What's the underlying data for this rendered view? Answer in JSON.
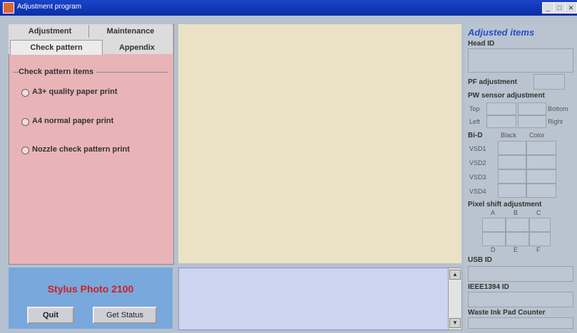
{
  "window": {
    "title": "Adjustment program",
    "controls": [
      "_",
      "□",
      "✕"
    ]
  },
  "tabs": {
    "row1": [
      "Adjustment",
      "Maintenance"
    ],
    "row2": [
      "Check pattern",
      "Appendix"
    ],
    "active": "Check pattern"
  },
  "check_pattern": {
    "group_label": "Check pattern items",
    "options": [
      "A3+ quality paper print",
      "A4 normal paper print",
      "Nozzle check pattern print"
    ]
  },
  "footer": {
    "printer_model": "Stylus Photo 2100",
    "quit_label": "Quit",
    "status_label": "Get Status"
  },
  "adjusted_items": {
    "heading": "Adjusted items",
    "head_id_label": "Head ID",
    "pf_label": "PF adjustment",
    "pw_label": "PW sensor adjustment",
    "pw_positions": {
      "top": "Top",
      "bottom": "Bottom",
      "left": "Left",
      "right": "Right"
    },
    "bid_label": "Bi-D",
    "bid_cols": [
      "Black",
      "Color"
    ],
    "bid_rows": [
      "VSD1",
      "VSD2",
      "VSD3",
      "VSD4"
    ],
    "pixel_shift_label": "Pixel shift adjustment",
    "pixel_cols_top": [
      "A",
      "B",
      "C"
    ],
    "pixel_cols_bottom": [
      "D",
      "E",
      "F"
    ],
    "usb_label": "USB ID",
    "ieee_label": "IEEE1394 ID",
    "waste_label": "Waste Ink Pad Counter"
  },
  "scroll": {
    "up": "▲",
    "down": "▼"
  },
  "colors": {
    "title_bar": "#0c2ea8",
    "brand": "#cf2020",
    "heading": "#2a4cc8"
  }
}
